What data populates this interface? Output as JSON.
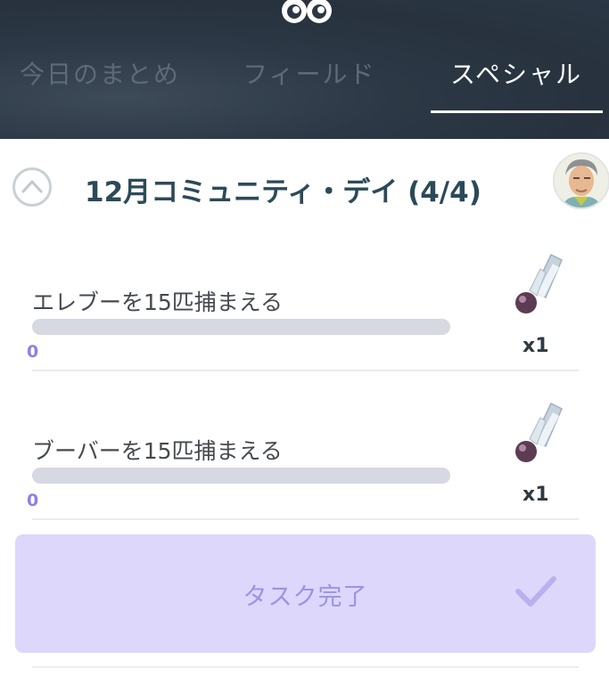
{
  "tabs": [
    {
      "label": "今日のまとめ",
      "active": false
    },
    {
      "label": "フィールド",
      "active": false
    },
    {
      "label": "スペシャル",
      "active": true
    }
  ],
  "section": {
    "title": "12月コミュニティ・デイ (4/4)",
    "collapse_icon": "chevron-up-icon",
    "avatar_icon": "professor-avatar"
  },
  "tasks": [
    {
      "label": "エレブーを15匹捕まえる",
      "progress": 0,
      "progress_text": "0",
      "reward_icon": "sinnoh-stone-icon",
      "reward_qty": "x1"
    },
    {
      "label": "ブーバーを15匹捕まえる",
      "progress": 0,
      "progress_text": "0",
      "reward_icon": "sinnoh-stone-icon",
      "reward_qty": "x1"
    }
  ],
  "complete_button": {
    "label": "タスク完了",
    "icon": "check-icon"
  },
  "colors": {
    "header_bg": "#2c3845",
    "progress_track": "#d6d8e2",
    "progress_text": "#8d80e4",
    "complete_bg": "#dcd7fb",
    "complete_text": "#9d92e6"
  }
}
